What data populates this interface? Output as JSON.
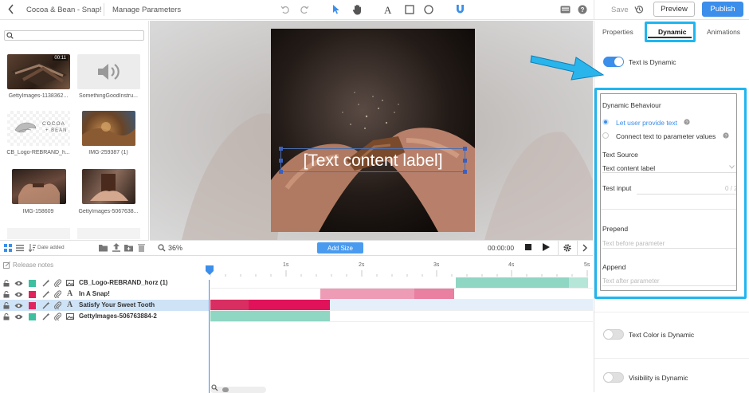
{
  "header": {
    "project_title": "Cocoa & Bean - Snap!",
    "manage_label": "Manage Parameters",
    "save_label": "Save",
    "preview_label": "Preview",
    "publish_label": "Publish"
  },
  "media": {
    "search_placeholder": "",
    "items": [
      {
        "caption": "GettyImages-1138362...",
        "duration": "00:11"
      },
      {
        "caption": "SomethingGoodInstru..."
      },
      {
        "caption": "CB_Logo-REBRAND_h...",
        "logo_line1": "COCOA",
        "logo_line2": "+ BEAN"
      },
      {
        "caption": "IMG-259387 (1)"
      },
      {
        "caption": "IMG-158609"
      },
      {
        "caption": "GettyImages-5067638..."
      }
    ],
    "sort_label": "Date added"
  },
  "stage": {
    "text_label": "[Text content label]",
    "zoom": "36%",
    "add_size_label": "Add Size",
    "timecode": "00:00:00"
  },
  "timeline": {
    "release_notes": "Release notes",
    "ticks": [
      "1s",
      "2s",
      "3s",
      "4s",
      "5s"
    ],
    "layers": [
      {
        "name": "CB_Logo-REBRAND_horz (1)",
        "swatch": "#3dbfa0",
        "type": "image",
        "selected": false
      },
      {
        "name": "In A Snap!",
        "swatch": "#e0245e",
        "type": "text",
        "selected": false
      },
      {
        "name": "Satisfy Your Sweet Tooth",
        "swatch": "#e0245e",
        "type": "text",
        "selected": true
      },
      {
        "name": "GettyImages-506763884-2",
        "swatch": "#3dbfa0",
        "type": "image",
        "selected": false
      }
    ]
  },
  "props": {
    "tabs": [
      "Properties",
      "Dynamic",
      "Animations"
    ],
    "active_tab": "Dynamic",
    "text_is_dynamic": {
      "label": "Text is Dynamic",
      "on": true
    },
    "behaviour_title": "Dynamic Behaviour",
    "options": [
      {
        "label": "Let user provide text",
        "selected": true
      },
      {
        "label": "Connect text to parameter values",
        "selected": false
      }
    ],
    "text_source_label": "Text Source",
    "text_source_value": "Text content label",
    "test_input_label": "Test input",
    "test_input_count": "0 / 25",
    "prepend_label": "Prepend",
    "prepend_placeholder": "Text before parameter",
    "append_label": "Append",
    "append_placeholder": "Text after parameter",
    "text_color_dynamic": {
      "label": "Text Color is Dynamic",
      "on": false
    },
    "visibility_dynamic": {
      "label": "Visibility is Dynamic",
      "on": false
    }
  },
  "colors": {
    "accent": "#3b8eea",
    "highlight": "#1fb6f0",
    "teal": "#3dbfa0",
    "pink": "#e0245e"
  }
}
